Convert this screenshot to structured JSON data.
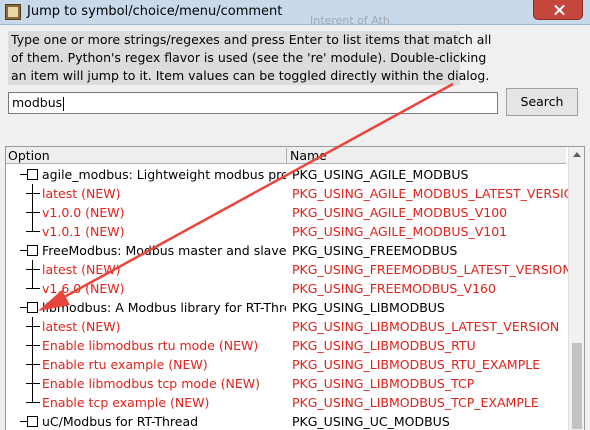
{
  "window": {
    "title": "Jump to symbol/choice/menu/comment",
    "background_text": "Interent of Ath"
  },
  "help": {
    "lines": [
      "Type one or more strings/regexes and press Enter to list items that match all",
      "of them. Python's regex flavor is used (see the 're' module). Double-clicking",
      "an item will jump to it. Item values can be toggled directly within the dialog."
    ]
  },
  "search": {
    "value": "modbus",
    "button_label": "Search"
  },
  "table": {
    "columns": [
      "Option",
      "Name"
    ],
    "rows": [
      {
        "option": "agile_modbus: Lightweight modbus protocol stack",
        "name": "PKG_USING_AGILE_MODBUS",
        "kind": "menu",
        "red": false
      },
      {
        "option": "latest (NEW)",
        "name": "PKG_USING_AGILE_MODBUS_LATEST_VERSION",
        "kind": "child",
        "red": true
      },
      {
        "option": "v1.0.0 (NEW)",
        "name": "PKG_USING_AGILE_MODBUS_V100",
        "kind": "child",
        "red": true
      },
      {
        "option": "v1.0.1 (NEW)",
        "name": "PKG_USING_AGILE_MODBUS_V101",
        "kind": "child-end",
        "red": true
      },
      {
        "option": "FreeModbus: Modbus master and slave stack",
        "name": "PKG_USING_FREEMODBUS",
        "kind": "menu",
        "red": false
      },
      {
        "option": "latest (NEW)",
        "name": "PKG_USING_FREEMODBUS_LATEST_VERSION",
        "kind": "child",
        "red": true
      },
      {
        "option": "v1.6.0 (NEW)",
        "name": "PKG_USING_FREEMODBUS_V160",
        "kind": "child-end",
        "red": true
      },
      {
        "option": "libmodbus: A Modbus library for RT-Thread",
        "name": "PKG_USING_LIBMODBUS",
        "kind": "menu",
        "red": false
      },
      {
        "option": "latest (NEW)",
        "name": "PKG_USING_LIBMODBUS_LATEST_VERSION",
        "kind": "child",
        "red": true
      },
      {
        "option": "Enable libmodbus rtu mode (NEW)",
        "name": "PKG_USING_LIBMODBUS_RTU",
        "kind": "child",
        "red": true
      },
      {
        "option": "Enable rtu example (NEW)",
        "name": "PKG_USING_LIBMODBUS_RTU_EXAMPLE",
        "kind": "child",
        "red": true
      },
      {
        "option": "Enable libmodbus tcp mode (NEW)",
        "name": "PKG_USING_LIBMODBUS_TCP",
        "kind": "child",
        "red": true
      },
      {
        "option": "Enable tcp example (NEW)",
        "name": "PKG_USING_LIBMODBUS_TCP_EXAMPLE",
        "kind": "child-end",
        "red": true
      },
      {
        "option": "uC/Modbus for RT-Thread",
        "name": "PKG_USING_UC_MODBUS",
        "kind": "menu",
        "red": false
      }
    ]
  },
  "colors": {
    "accent_red": "#e0221b",
    "arrow": "#e8453c",
    "title_bar": "#c8d9ec"
  },
  "icons": [
    "app-icon",
    "close-icon",
    "checkbox-icon",
    "tree-branch-icon",
    "scroll-up-icon",
    "annotation-arrow"
  ]
}
